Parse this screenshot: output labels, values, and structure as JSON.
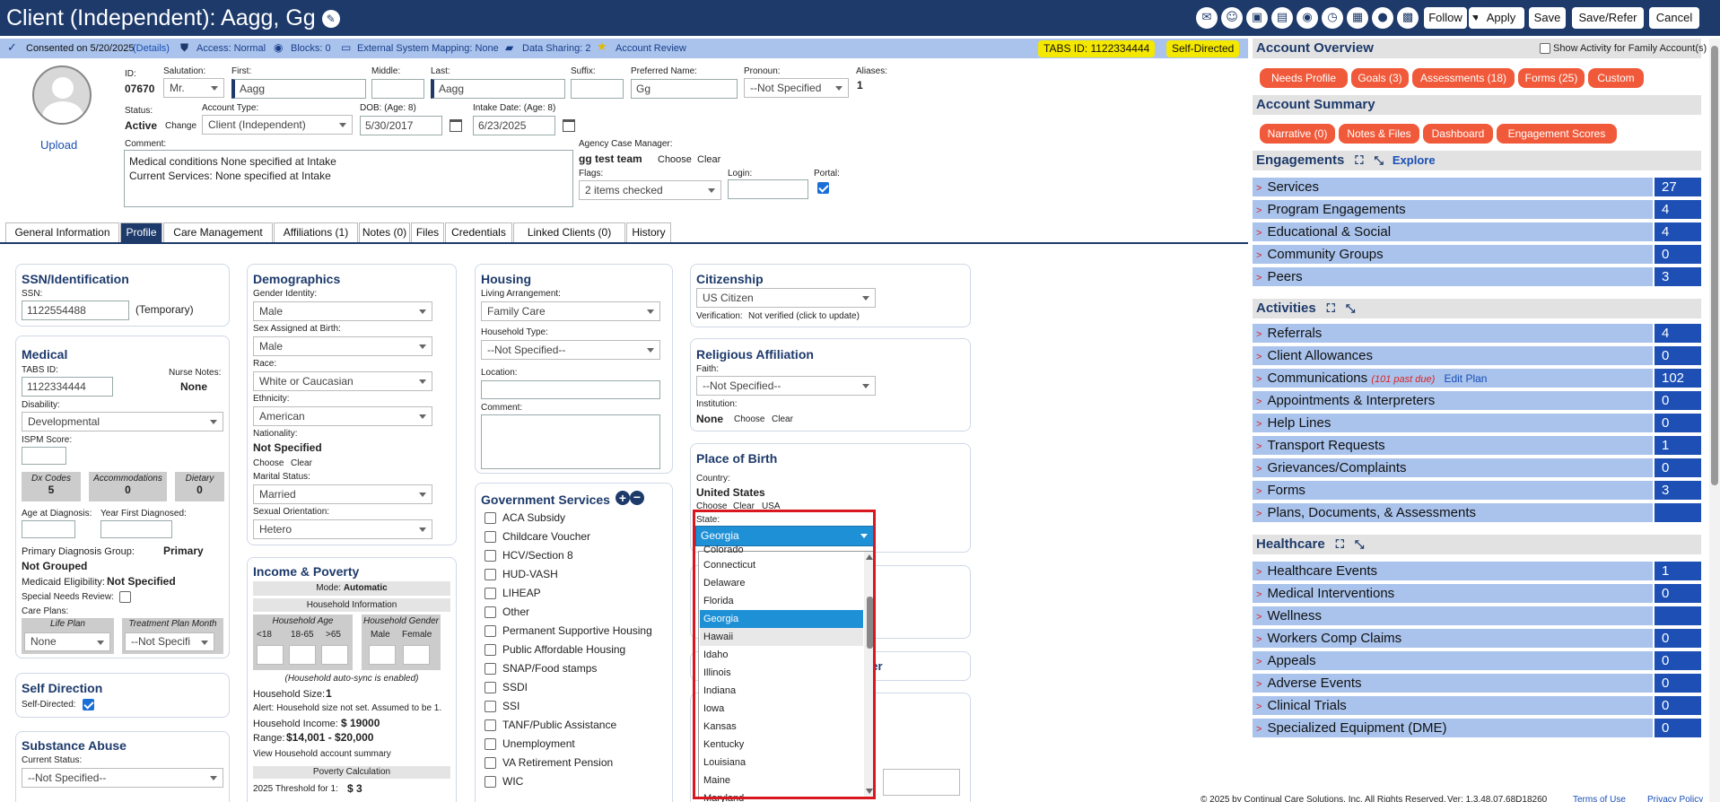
{
  "header": {
    "title": "Client (Independent): Aagg, Gg",
    "buttons": {
      "follow": "Follow",
      "apply": "Apply",
      "save": "Save",
      "save_refer": "Save/Refer",
      "cancel": "Cancel"
    }
  },
  "info": {
    "consented": "Consented on 5/20/2025",
    "details": "(Details)",
    "access": "Access: Normal",
    "blocks": "Blocks: 0",
    "ext_mapping": "External System Mapping: None",
    "data_sharing": "Data Sharing: 2",
    "account_review": "Account Review",
    "tabs_id": "TABS ID: 1122334444",
    "self_directed": "Self-Directed"
  },
  "client": {
    "upload": "Upload",
    "id_label": "ID:",
    "id": "07670",
    "salutation_label": "Salutation:",
    "salutation": "Mr.",
    "first_label": "First:",
    "first": "Aagg",
    "middle_label": "Middle:",
    "middle": "",
    "last_label": "Last:",
    "last": "Aagg",
    "suffix_label": "Suffix:",
    "suffix": "",
    "preferred_label": "Preferred Name:",
    "preferred": "Gg",
    "pronoun_label": "Pronoun:",
    "pronoun": "--Not Specified",
    "aliases_label": "Aliases:",
    "aliases": "1",
    "status_label": "Status:",
    "status": "Active",
    "change": "Change",
    "account_type_label": "Account Type:",
    "account_type": "Client (Independent)",
    "dob_label": "DOB: (Age: 8)",
    "dob": "5/30/2017",
    "intake_label": "Intake Date: (Age: 8)",
    "intake": "6/23/2025",
    "comment_label": "Comment:",
    "comment_line1": "Medical conditions None specified at Intake",
    "comment_line2": "Current Services: None specified at Intake",
    "agency_cm_label": "Agency Case Manager:",
    "agency_cm": "gg test team",
    "choose": "Choose",
    "clear": "Clear",
    "flags_label": "Flags:",
    "flags": "2 items checked",
    "login_label": "Login:",
    "login": "",
    "portal_label": "Portal:"
  },
  "tabs": [
    "General Information",
    "Profile",
    "Care Management",
    "Affiliations (1)",
    "Notes (0)",
    "Files",
    "Credentials",
    "Linked Clients (0)",
    "History"
  ],
  "ssn": {
    "title": "SSN/Identification",
    "label": "SSN:",
    "value": "1122554488",
    "note": "(Temporary)"
  },
  "medical": {
    "title": "Medical",
    "tabs_label": "TABS ID:",
    "tabs_value": "1122334444",
    "nurse_label": "Nurse Notes:",
    "nurse_value": "None",
    "disability_label": "Disability:",
    "disability": "Developmental",
    "ispm_label": "ISPM Score:",
    "boxes": [
      {
        "label": "Dx Codes",
        "value": "5"
      },
      {
        "label": "Accommodations",
        "value": "0"
      },
      {
        "label": "Dietary",
        "value": "0"
      }
    ],
    "age_diag_label": "Age at Diagnosis:",
    "year_diag_label": "Year First Diagnosed:",
    "primary_group_label": "Primary Diagnosis Group:",
    "primary_group": "Primary Not Grouped",
    "medicaid_label": "Medicaid Eligibility:",
    "medicaid": "Not Specified",
    "special_needs": "Special Needs Review:",
    "care_plans": "Care Plans:",
    "life_plan": "Life Plan",
    "life_plan_value": "None",
    "treatment_plan": "Treatment Plan Month",
    "treatment_value": "--Not Specifi"
  },
  "self_direction": {
    "title": "Self Direction",
    "label": "Self-Directed:"
  },
  "substance": {
    "title": "Substance Abuse",
    "label": "Current Status:",
    "value": "--Not Specified--"
  },
  "demographics": {
    "title": "Demographics",
    "gender_label": "Gender Identity:",
    "gender": "Male",
    "sex_label": "Sex Assigned at Birth:",
    "sex": "Male",
    "race_label": "Race:",
    "race": "White or Caucasian",
    "ethnicity_label": "Ethnicity:",
    "ethnicity": "American",
    "nationality_label": "Nationality:",
    "nationality": "Not Specified",
    "choose": "Choose",
    "clear": "Clear",
    "marital_label": "Marital Status:",
    "marital": "Married",
    "orientation_label": "Sexual Orientation:",
    "orientation": "Hetero"
  },
  "income": {
    "title": "Income & Poverty",
    "mode_label": "Mode:",
    "mode": "Automatic",
    "household_info": "Household Information",
    "household_age": "Household Age",
    "ages": [
      "<18",
      "18-65",
      ">65"
    ],
    "household_gender": "Household Gender",
    "genders": [
      "Male",
      "Female"
    ],
    "auto_sync": "(Household auto-sync is enabled)",
    "size_label": "Household Size:",
    "size": "1",
    "alert": "Alert: Household size not set. Assumed to be 1.",
    "income_label": "Household Income:",
    "income_value": "$ 19000",
    "range_label": "Range:",
    "range_value": "$14,001 - $20,000",
    "view_summary": "View Household account summary",
    "poverty_calc": "Poverty Calculation",
    "threshold_label": "2025 Threshold for 1:",
    "threshold_value": "$ 3"
  },
  "housing": {
    "title": "Housing",
    "living_label": "Living Arrangement:",
    "living": "Family Care",
    "type_label": "Household Type:",
    "type": "--Not Specified--",
    "location_label": "Location:",
    "comment_label": "Comment:"
  },
  "government": {
    "title": "Government Services",
    "items": [
      "ACA Subsidy",
      "Childcare Voucher",
      "HCV/Section 8",
      "HUD-VASH",
      "LIHEAP",
      "Other",
      "Permanent Supportive Housing",
      "Public Affordable Housing",
      "SNAP/Food stamps",
      "SSDI",
      "SSI",
      "TANF/Public Assistance",
      "Unemployment",
      "VA Retirement Pension",
      "WIC"
    ]
  },
  "citizenship": {
    "title": "Citizenship",
    "value": "US Citizen",
    "verification_label": "Verification:",
    "verification": "Not verified (click to update)"
  },
  "religion": {
    "title": "Religious Affiliation",
    "faith_label": "Faith:",
    "faith": "--Not Specified--",
    "institution_label": "Institution:",
    "institution": "None",
    "choose": "Choose",
    "clear": "Clear"
  },
  "birth": {
    "title": "Place of Birth",
    "country_label": "Country:",
    "country": "United States",
    "choose": "Choose",
    "clear": "Clear",
    "usa": "USA",
    "state_label": "State:",
    "state": "Georgia",
    "options": [
      "Colorado",
      "Connecticut",
      "Delaware",
      "Florida",
      "Georgia",
      "Hawaii",
      "Idaho",
      "Illinois",
      "Indiana",
      "Iowa",
      "Kansas",
      "Kentucky",
      "Louisiana",
      "Maine",
      "Maryland"
    ],
    "hidden_title_fragment": "ver"
  },
  "overview": {
    "title": "Account Overview",
    "show_activity": "Show Activity for Family Account(s)",
    "pills": [
      "Needs Profile",
      "Goals (3)",
      "Assessments (18)",
      "Forms (25)",
      "Custom"
    ]
  },
  "summary": {
    "title": "Account Summary",
    "pills": [
      "Narrative (0)",
      "Notes & Files",
      "Dashboard",
      "Engagement Scores"
    ]
  },
  "engagements": {
    "title": "Engagements",
    "explore": "Explore",
    "rows": [
      {
        "name": "Services",
        "count": "27"
      },
      {
        "name": "Program Engagements",
        "count": "4"
      },
      {
        "name": "Educational & Social",
        "count": "4"
      },
      {
        "name": "Community Groups",
        "count": "0"
      },
      {
        "name": "Peers",
        "count": "3"
      }
    ]
  },
  "activities": {
    "title": "Activities",
    "rows": [
      {
        "name": "Referrals",
        "count": "4"
      },
      {
        "name": "Client Allowances",
        "count": "0"
      },
      {
        "name": "Communications",
        "count": "102",
        "extra": "(101 past due)",
        "edit": "Edit Plan"
      },
      {
        "name": "Appointments & Interpreters",
        "count": "0"
      },
      {
        "name": "Help Lines",
        "count": "0"
      },
      {
        "name": "Transport Requests",
        "count": "1"
      },
      {
        "name": "Grievances/Complaints",
        "count": "0"
      },
      {
        "name": "Forms",
        "count": "3"
      },
      {
        "name": "Plans, Documents, & Assessments",
        "count": ""
      }
    ]
  },
  "healthcare": {
    "title": "Healthcare",
    "rows": [
      {
        "name": "Healthcare Events",
        "count": "1"
      },
      {
        "name": "Medical Interventions",
        "count": "0"
      },
      {
        "name": "Wellness",
        "count": ""
      },
      {
        "name": "Workers Comp Claims",
        "count": "0"
      },
      {
        "name": "Appeals",
        "count": "0"
      },
      {
        "name": "Adverse Events",
        "count": "0"
      },
      {
        "name": "Clinical Trials",
        "count": "0"
      },
      {
        "name": "Specialized Equipment (DME)",
        "count": "0"
      }
    ]
  },
  "footer": {
    "copyright": "© 2025 by Continual Care Solutions, Inc. All Rights Reserved.",
    "version": "Ver: 1.3.48.07.68D18260",
    "terms": "Terms of Use",
    "privacy": "Privacy Policy"
  }
}
